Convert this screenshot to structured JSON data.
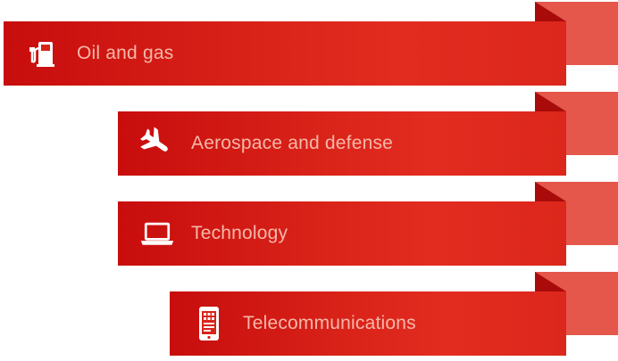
{
  "ribbons": [
    {
      "label": "Oil and gas",
      "icon": "fuel-pump-icon"
    },
    {
      "label": "Aerospace and defense",
      "icon": "airplane-icon"
    },
    {
      "label": "Technology",
      "icon": "laptop-icon"
    },
    {
      "label": "Telecommunications",
      "icon": "smartphone-icon"
    }
  ],
  "colors": {
    "band": "#d92319",
    "fold": "#e4574a",
    "label": "#f6b7a9",
    "icon": "#ffffff"
  }
}
